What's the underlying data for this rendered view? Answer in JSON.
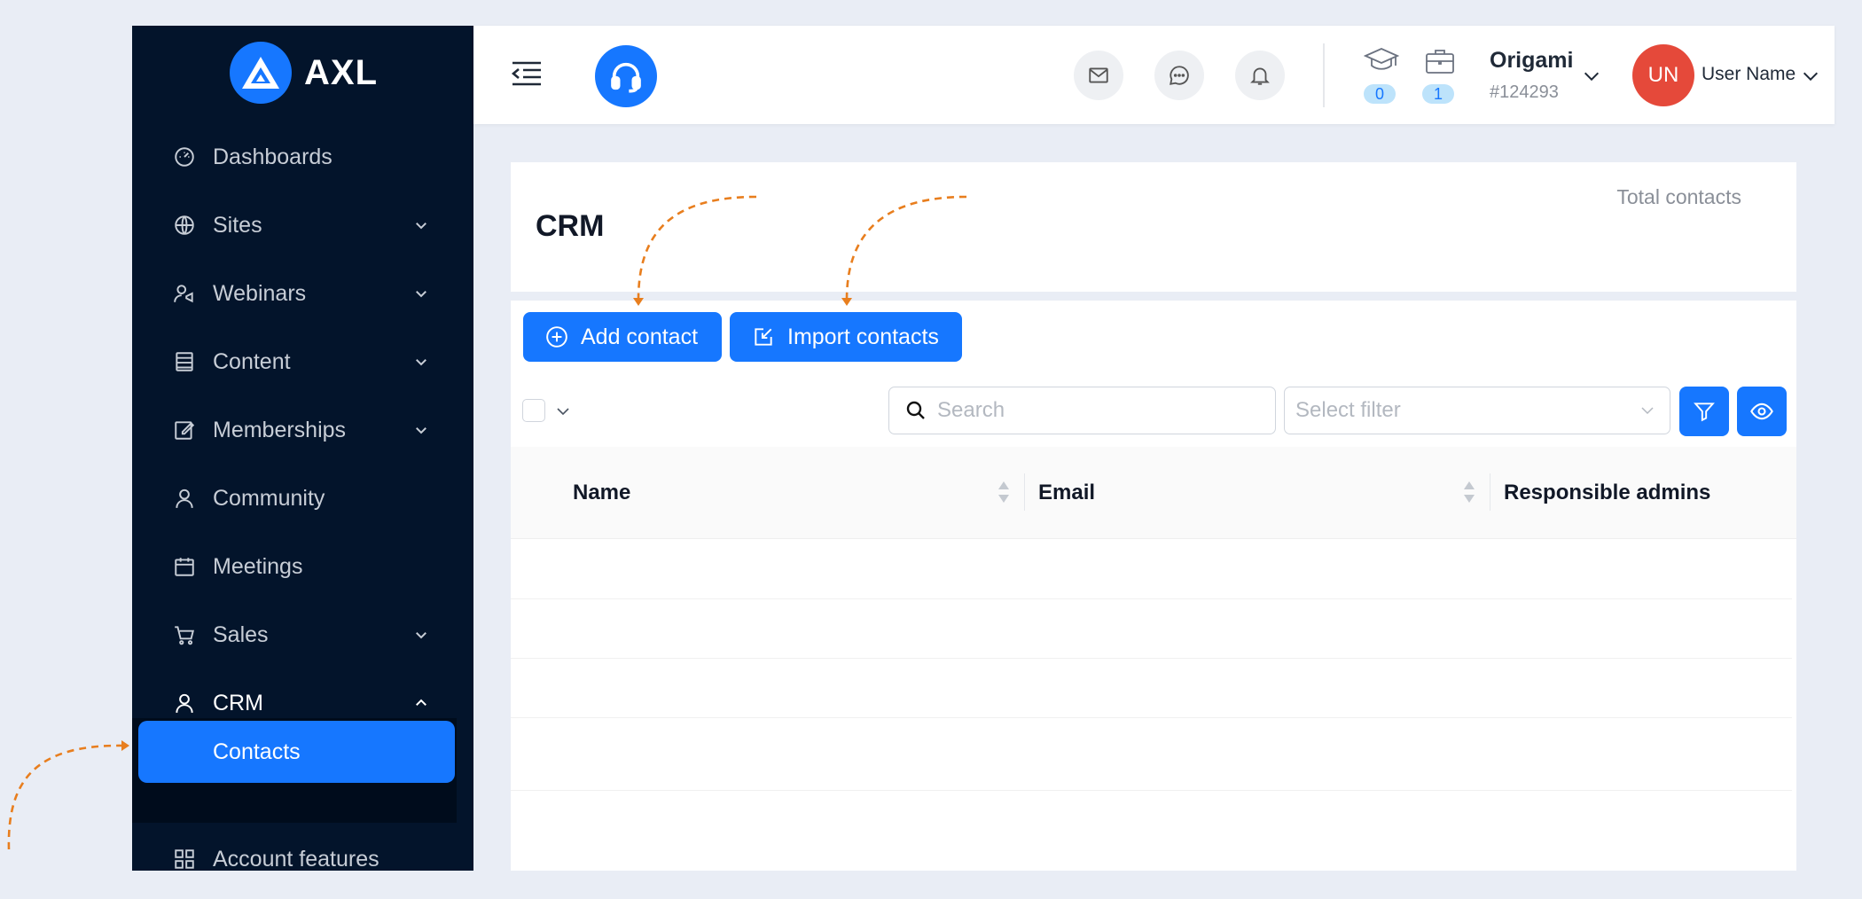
{
  "app": {
    "logo_text": "AXL"
  },
  "sidebar": {
    "items": [
      {
        "label": "Dashboards",
        "icon": "dashboard-icon",
        "expandable": false
      },
      {
        "label": "Sites",
        "icon": "globe-icon",
        "expandable": true
      },
      {
        "label": "Webinars",
        "icon": "webinar-icon",
        "expandable": true
      },
      {
        "label": "Content",
        "icon": "content-icon",
        "expandable": true
      },
      {
        "label": "Memberships",
        "icon": "edit-icon",
        "expandable": true
      },
      {
        "label": "Community",
        "icon": "user-icon",
        "expandable": false
      },
      {
        "label": "Meetings",
        "icon": "calendar-icon",
        "expandable": false
      },
      {
        "label": "Sales",
        "icon": "cart-icon",
        "expandable": true
      },
      {
        "label": "CRM",
        "icon": "user-icon",
        "expandable": true,
        "expanded": true
      },
      {
        "label": "Account features",
        "icon": "grid-icon",
        "expandable": false
      }
    ],
    "active_subitem": "Contacts"
  },
  "header": {
    "icons": [
      "menu-fold-icon",
      "headset-icon",
      "mail-icon",
      "chat-icon",
      "bell-icon",
      "graduation-cap-icon",
      "briefcase-icon"
    ],
    "courses_count": "0",
    "jobs_count": "1",
    "org_name": "Origami",
    "org_id": "#124293",
    "avatar_initials": "UN",
    "user_name": "User Name"
  },
  "crm": {
    "title": "CRM",
    "total_label": "Total contacts"
  },
  "toolbar": {
    "add_label": "Add contact",
    "import_label": "Import contacts",
    "search_placeholder": "Search",
    "filter_placeholder": "Select filter"
  },
  "table": {
    "columns": [
      "Name",
      "Email",
      "Responsible admins"
    ]
  },
  "colors": {
    "primary": "#1677ff",
    "sidebar": "#03142b",
    "avatar": "#e5493a",
    "annotation": "#e87e1e",
    "background": "#e9edf5"
  }
}
